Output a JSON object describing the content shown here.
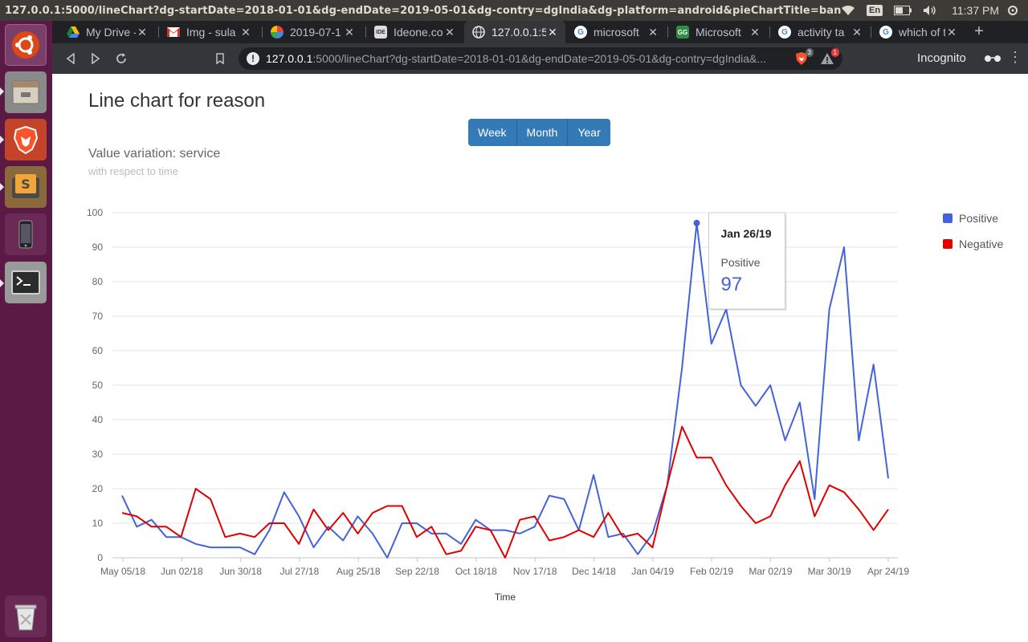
{
  "os": {
    "window_title": "127.0.0.1:5000/lineChart?dg-startDate=2018-01-01&dg-endDate=2019-05-01&dg-contry=dgIndia&dg-platform=android&pieChartTitle=bank&sl",
    "language": "En",
    "clock": "11:37 PM",
    "launcher": [
      "ubuntu-dash-icon",
      "files-icon",
      "brave-browser-icon",
      "sublime-text-icon",
      "phone-icon",
      "terminal-icon",
      "trash-icon"
    ]
  },
  "browser": {
    "tabs": [
      {
        "label": "My Drive -",
        "icon": "drive-icon"
      },
      {
        "label": "Img - sula",
        "icon": "gmail-icon"
      },
      {
        "label": "2019-07-1",
        "icon": "photos-icon"
      },
      {
        "label": "Ideone.co",
        "icon": "ideone-icon"
      },
      {
        "label": "127.0.0.1:5",
        "icon": "globe-icon",
        "active": true
      },
      {
        "label": "microsoft",
        "icon": "google-icon"
      },
      {
        "label": "Microsoft",
        "icon": "gfg-icon"
      },
      {
        "label": "activity ta",
        "icon": "google-icon"
      },
      {
        "label": "which of t",
        "icon": "google-icon"
      }
    ],
    "url_host": "127.0.0.1",
    "url_rest": ":5000/lineChart?dg-startDate=2018-01-01&dg-endDate=2019-05-01&dg-contry=dgIndia&...",
    "ext_brave_badge": "3",
    "ext_alert_badge": "1",
    "incognito_label": "Incognito"
  },
  "page": {
    "title": "Line chart for reason",
    "range_buttons": [
      "Week",
      "Month",
      "Year"
    ],
    "chart_title": "Value variation: service",
    "chart_subtitle": "with respect to time"
  },
  "colors": {
    "positive": "#4363d8",
    "negative": "#e00000",
    "button": "#337ab7"
  },
  "chart_data": {
    "type": "line",
    "title": "Value variation: service",
    "subtitle": "with respect to time",
    "xlabel": "Time",
    "ylabel": "",
    "ylim": [
      0,
      100
    ],
    "yticks": [
      0,
      10,
      20,
      30,
      40,
      50,
      60,
      70,
      80,
      90,
      100
    ],
    "xtick_labels": [
      "May 05/18",
      "Jun 02/18",
      "Jun 30/18",
      "Jul 27/18",
      "Aug 25/18",
      "Sep 22/18",
      "Oct 18/18",
      "Nov 17/18",
      "Dec 14/18",
      "Jan 04/19",
      "Feb 02/19",
      "Mar 02/19",
      "Mar 30/19",
      "Apr 24/19"
    ],
    "legend_position": "right",
    "grid": true,
    "series": [
      {
        "name": "Positive",
        "color": "#4363d8",
        "values": [
          18,
          9,
          11,
          6,
          6,
          4,
          3,
          3,
          3,
          1,
          8,
          19,
          12,
          3,
          9,
          5,
          12,
          7,
          0,
          10,
          10,
          7,
          7,
          4,
          11,
          8,
          8,
          7,
          9,
          18,
          17,
          8,
          24,
          6,
          7,
          1,
          7,
          21,
          55,
          97,
          62,
          72,
          50,
          44,
          50,
          34,
          45,
          17,
          72,
          90,
          34,
          56,
          23
        ]
      },
      {
        "name": "Negative",
        "color": "#e00000",
        "values": [
          13,
          12,
          9,
          9,
          6,
          20,
          17,
          6,
          7,
          6,
          10,
          10,
          4,
          14,
          8,
          13,
          7,
          13,
          15,
          15,
          6,
          9,
          1,
          2,
          9,
          8,
          0,
          11,
          12,
          5,
          6,
          8,
          6,
          13,
          6,
          7,
          3,
          21,
          38,
          29,
          29,
          21,
          15,
          10,
          12,
          21,
          28,
          12,
          21,
          19,
          14,
          8,
          14
        ]
      }
    ],
    "tooltip": {
      "date": "Jan 26/19",
      "series": "Positive",
      "value": 97
    }
  }
}
